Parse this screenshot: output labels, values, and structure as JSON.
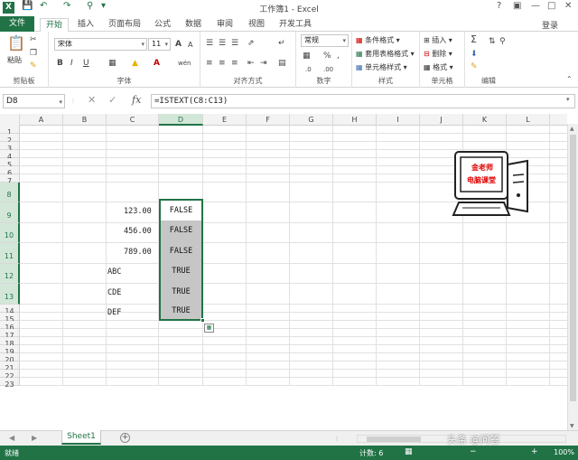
{
  "titlebar": {
    "title": "工作簿1 - Excel",
    "logo": "X",
    "undo_icon": "undo-icon",
    "redo_icon": "redo-icon",
    "save_icon": "save-icon",
    "help": "?",
    "minimize": "—",
    "restore": "□",
    "close": "✕"
  },
  "tabs": [
    "文件",
    "开始",
    "插入",
    "页面布局",
    "公式",
    "数据",
    "审阅",
    "视图",
    "开发工具"
  ],
  "active_tab": "开始",
  "login": "登录",
  "ribbon": {
    "clipboard": {
      "paste": "粘贴",
      "label": "剪贴板"
    },
    "font": {
      "name": "宋体",
      "size": "11",
      "label": "字体",
      "bold": "B",
      "italic": "I",
      "underline": "U",
      "grow": "A",
      "shrink": "A",
      "font_color": "A"
    },
    "alignment": {
      "label": "对齐方式"
    },
    "number": {
      "format": "常规",
      "label": "数字",
      "percent": "%",
      "comma": ","
    },
    "styles": {
      "conditional": "条件格式",
      "table": "套用表格格式",
      "cell": "单元格样式",
      "label": "样式"
    },
    "cells": {
      "insert": "插入",
      "delete": "删除",
      "format": "格式",
      "label": "单元格"
    },
    "editing": {
      "label": "编辑",
      "sum": "Σ"
    }
  },
  "formula_bar": {
    "name_box": "D8",
    "formula": "=ISTEXT(C8:C13)",
    "fx": "fx",
    "cancel": "✕",
    "enter": "✓"
  },
  "columns": [
    "A",
    "B",
    "C",
    "D",
    "E",
    "F",
    "G",
    "H",
    "I",
    "J",
    "K",
    "L"
  ],
  "selected_column": "D",
  "rows": [
    "1",
    "2",
    "3",
    "4",
    "5",
    "6",
    "7",
    "8",
    "9",
    "10",
    "11",
    "12",
    "13",
    "14",
    "15",
    "16",
    "17",
    "18",
    "19",
    "20",
    "21",
    "22",
    "23"
  ],
  "c_values": [
    "123.00",
    "456.00",
    "789.00",
    "ABC",
    "CDE",
    "DEF"
  ],
  "d_values": [
    "FALSE",
    "FALSE",
    "FALSE",
    "TRUE",
    "TRUE",
    "TRUE"
  ],
  "logo": {
    "line1": "金老师",
    "line2": "电脑课堂"
  },
  "sheet": {
    "name": "Sheet1",
    "add": "+"
  },
  "status": {
    "ready": "就绪",
    "count": "计数: 6",
    "zoom": "100%"
  },
  "watermark": "头条 @问答"
}
